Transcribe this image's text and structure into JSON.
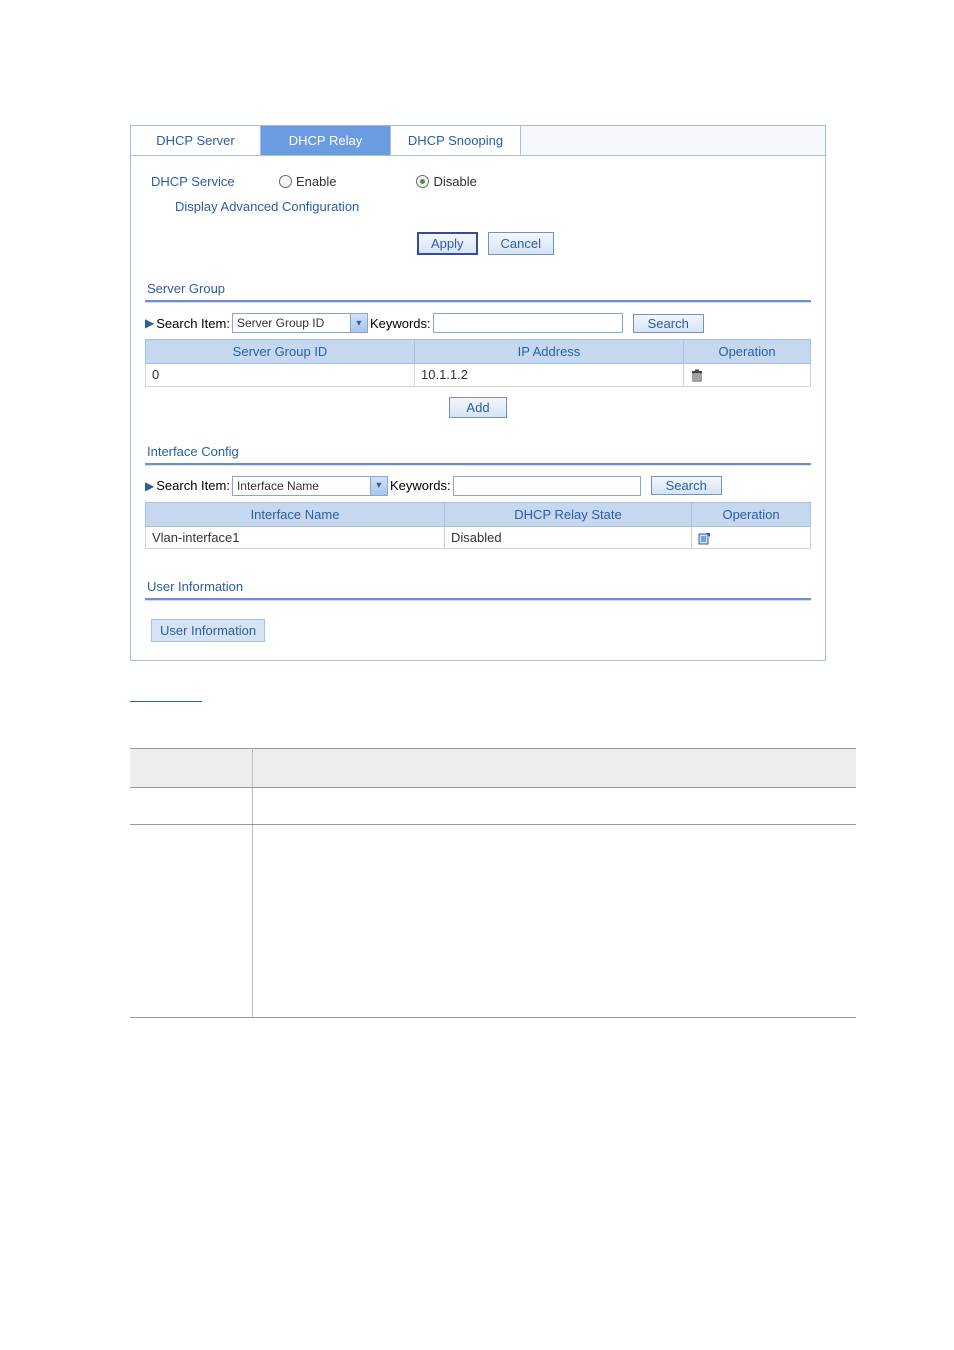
{
  "tabs": {
    "server": "DHCP Server",
    "relay": "DHCP Relay",
    "snooping": "DHCP Snooping"
  },
  "service": {
    "label": "DHCP Service",
    "enable": "Enable",
    "disable": "Disable"
  },
  "adv_link": "Display Advanced Configuration",
  "buttons": {
    "apply": "Apply",
    "cancel": "Cancel",
    "search": "Search",
    "add": "Add"
  },
  "server_group": {
    "title": "Server Group",
    "search_item_label": "Search Item:",
    "search_item_value": "Server Group ID",
    "keywords_label": "Keywords:",
    "keywords_value": "",
    "cols": {
      "id": "Server Group ID",
      "ip": "IP Address",
      "op": "Operation"
    },
    "rows": [
      {
        "id": "0",
        "ip": "10.1.1.2"
      }
    ]
  },
  "interface_config": {
    "title": "Interface Config",
    "search_item_label": "Search Item:",
    "search_item_value": "Interface Name",
    "keywords_label": "Keywords:",
    "keywords_value": "",
    "cols": {
      "name": "Interface Name",
      "state": "DHCP Relay State",
      "op": "Operation"
    },
    "rows": [
      {
        "name": "Vlan-interface1",
        "state": "Disabled"
      }
    ]
  },
  "user_info": {
    "title": "User Information",
    "button": "User Information"
  }
}
